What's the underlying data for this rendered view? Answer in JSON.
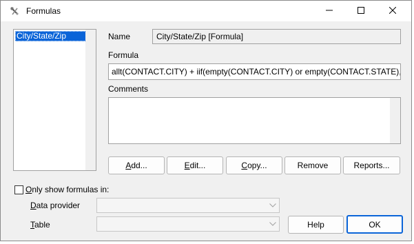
{
  "window": {
    "title": "Formulas"
  },
  "list": {
    "items": [
      {
        "label": "City/State/Zip",
        "selected": true
      }
    ]
  },
  "name": {
    "label": "Name",
    "value": "City/State/Zip [Formula]"
  },
  "formula": {
    "label": "Formula",
    "value": "allt(CONTACT.CITY) + iif(empty(CONTACT.CITY) or empty(CONTACT.STATE), \""
  },
  "comments": {
    "label": "Comments",
    "value": ""
  },
  "actions": {
    "add": {
      "pre": "",
      "ul": "A",
      "post": "dd..."
    },
    "edit": {
      "pre": "",
      "ul": "E",
      "post": "dit..."
    },
    "copy": {
      "pre": "",
      "ul": "C",
      "post": "opy..."
    },
    "remove": "Remove",
    "reports": "Reports..."
  },
  "filter": {
    "checkbox": {
      "ul": "O",
      "post": "nly show formulas in:",
      "checked": false
    },
    "data_provider": {
      "ul": "D",
      "post": "ata provider",
      "value": ""
    },
    "table": {
      "ul": "T",
      "post": "able",
      "value": ""
    }
  },
  "footer": {
    "help": "Help",
    "ok": "OK"
  },
  "colors": {
    "accent": "#0a64d8",
    "window_bg": "#f0f0f0"
  },
  "icons": {
    "app": "hammer-wrench-icon",
    "min": "minimize-icon",
    "max": "maximize-icon",
    "close": "close-icon"
  }
}
